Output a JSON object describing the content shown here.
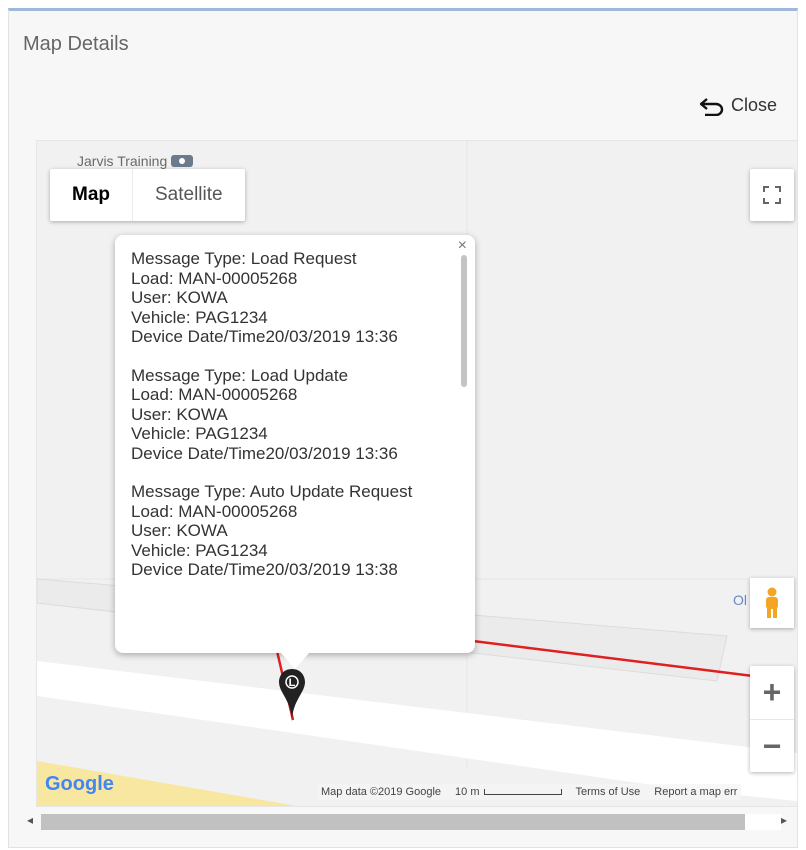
{
  "dialog": {
    "title": "Map Details",
    "close_label": "Close"
  },
  "map": {
    "poi_label": "Jarvis Training",
    "map_type": {
      "map_label": "Map",
      "satellite_label": "Satellite",
      "selected": "Map"
    },
    "side_label": "Ol",
    "zoom_in": "+",
    "zoom_out": "−",
    "google_logo": "Google",
    "attribution": {
      "map_data": "Map data ©2019 Google",
      "scale": "10 m",
      "terms": "Terms of Use",
      "report": "Report a map err"
    },
    "route_color": "#e02020",
    "marker_letter": "L"
  },
  "infowindow": {
    "close": "×",
    "messages": [
      {
        "type": "Message Type: Load Request",
        "load": "Load: MAN-00005268",
        "user": "User: KOWA",
        "vehicle": "Vehicle: PAG1234",
        "datetime": "Device Date/Time20/03/2019 13:36"
      },
      {
        "type": "Message Type: Load Update",
        "load": "Load: MAN-00005268",
        "user": "User: KOWA",
        "vehicle": "Vehicle: PAG1234",
        "datetime": "Device Date/Time20/03/2019 13:36"
      },
      {
        "type": "Message Type: Auto Update Request",
        "load": "Load: MAN-00005268",
        "user": "User: KOWA",
        "vehicle": "Vehicle: PAG1234",
        "datetime": "Device Date/Time20/03/2019 13:38"
      }
    ]
  }
}
